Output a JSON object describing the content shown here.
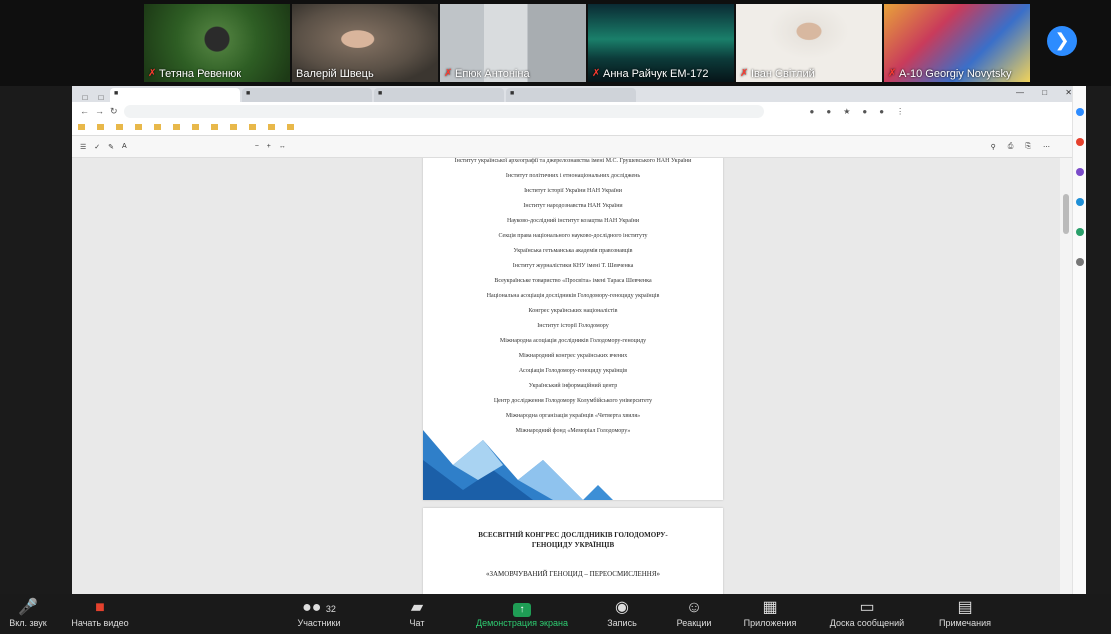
{
  "participants": [
    {
      "name": "Тетяна Ревенюк",
      "muted": true
    },
    {
      "name": "Валерій Швець",
      "muted": false
    },
    {
      "name": "Епюк Антоніна",
      "muted": true
    },
    {
      "name": "Анна Райчук ЕМ-172",
      "muted": true
    },
    {
      "name": "Іван Світлий",
      "muted": true
    },
    {
      "name": "A-10 Georgiy Novytsky",
      "muted": true
    }
  ],
  "pdf": {
    "page1_lines": [
      "Інститут української археографії та джерелознавства імені М.С. Грушевського НАН України",
      "Інститут політичних і етнонаціональних досліджень",
      "Інститут історії України НАН України",
      "Інститут народознавства НАН України",
      "Науково-дослідний інститут козацтва НАН України",
      "Секція права національного науково-дослідного інституту",
      "Українська гетьманська академія правознавців",
      "Інститут журналістики КНУ імені Т. Шевченка",
      "Всеукраїнське товариство «Просвіта» імені Тараса Шевченка",
      "Національна асоціація дослідників Голодомору-геноциду українців",
      "Конгрес українських націоналістів",
      "Інститут історії Голодомору",
      "Міжнародна асоціація дослідників Голодомору-геноциду",
      "Міжнародний конгрес українських вчених",
      "Асоціація Голодомору-геноциду українців",
      "Український інформаційний центр",
      "Центр дослідження Голодомору Колумбійського університету",
      "Міжнародна організація українців «Четверта хвиля»",
      "Міжнародний фонд «Меморіал Голодомору»"
    ],
    "page2_title": "ВСЕСВІТНІЙ КОНГРЕС ДОСЛІДНИКІВ ГОЛОДОМОРУ-ГЕНОЦИДУ УКРАЇНЦІВ",
    "page2_sub": "«ЗАМОВЧУВАНИЙ ГЕНОЦИД – ПЕРЕОСМИСЛЕННЯ»"
  },
  "controls": {
    "mute": "Вкл. звук",
    "video": "Начать видео",
    "participants": "Участники",
    "participants_count": "32",
    "chat": "Чат",
    "share": "Демонстрация экрана",
    "record": "Запись",
    "reactions": "Реакции",
    "apps": "Приложения",
    "whiteboard": "Доска сообщений",
    "notes": "Примечания"
  },
  "colors": {
    "zoom_blue": "#2d8cff",
    "share_green": "#1f9d55",
    "muted_red": "#ff3b30",
    "deco_blue": "#3d8fd6"
  },
  "icons": [
    "mic-off-icon",
    "video-off-icon",
    "participants-icon",
    "chat-icon",
    "share-screen-icon",
    "record-icon",
    "reactions-icon",
    "apps-icon",
    "whiteboard-icon",
    "notes-icon",
    "next-page-icon"
  ]
}
